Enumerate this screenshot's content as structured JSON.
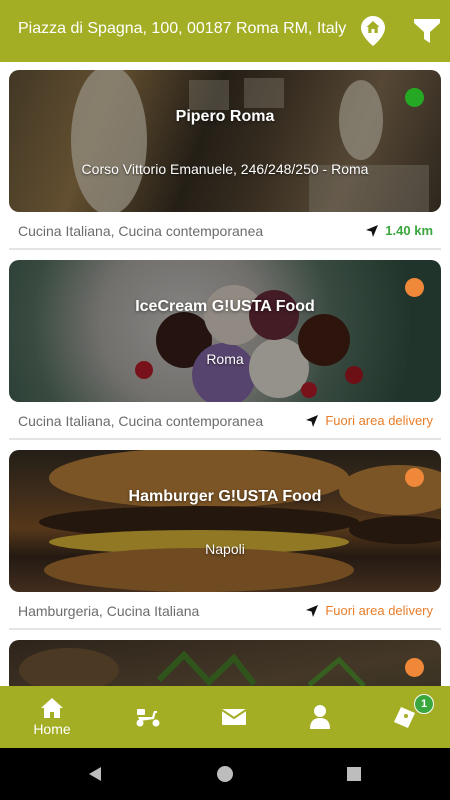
{
  "header": {
    "address": "Piazza di Spagna, 100, 00187 Roma RM, Italy",
    "location_icon": "home-pin-icon",
    "filter_icon": "filter-icon"
  },
  "restaurants": [
    {
      "name": "Pipero Roma",
      "address": "Corso Vittorio Emanuele, 246/248/250 - Roma",
      "cuisine": "Cucina Italiana, Cucina contemporanea",
      "distance": "1.40 km",
      "status_color": "#25a924"
    },
    {
      "name": "IceCream G!USTA Food",
      "address": "Roma",
      "cuisine": "Cucina Italiana, Cucina contemporanea",
      "distance": "Fuori area delivery",
      "status_color": "#f0883a"
    },
    {
      "name": "Hamburger G!USTA Food",
      "address": "Napoli",
      "cuisine": "Hamburgeria, Cucina Italiana",
      "distance": "Fuori area delivery",
      "status_color": "#f0883a"
    },
    {
      "name": "",
      "address": "",
      "cuisine": "",
      "distance": "",
      "status_color": "#f0883a"
    }
  ],
  "bottom_nav": {
    "home_label": "Home",
    "cart_badge": "1",
    "items": [
      "home-icon",
      "scooter-icon",
      "mail-icon",
      "user-icon",
      "coupon-icon"
    ]
  },
  "colors": {
    "brand": "#a3ae25",
    "green": "#3aa63e",
    "orange": "#e87d29"
  }
}
